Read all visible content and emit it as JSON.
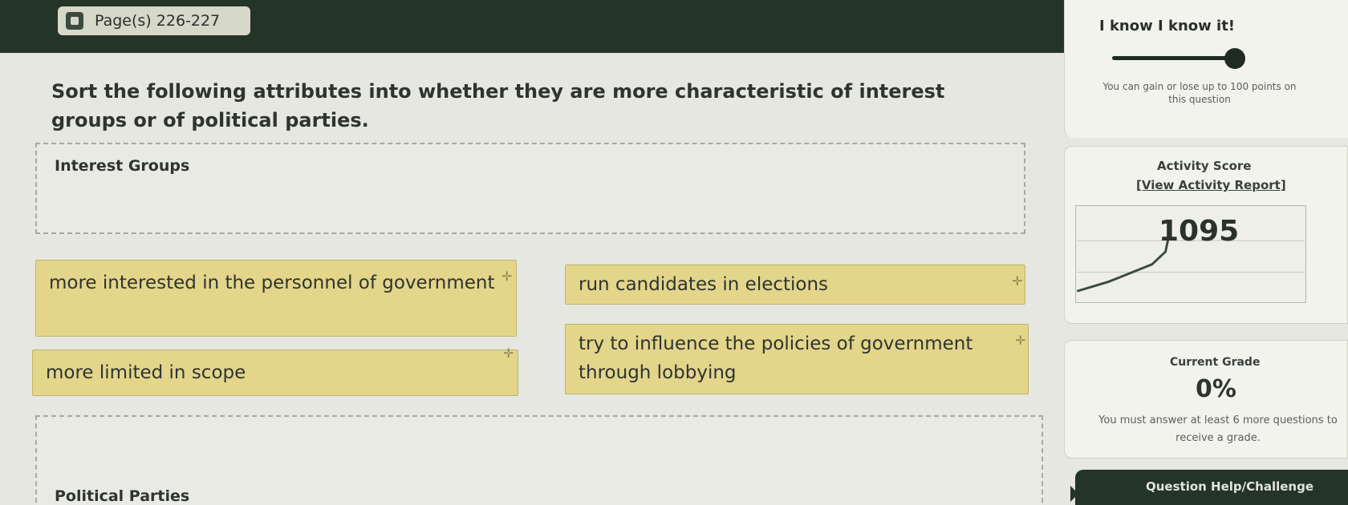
{
  "header": {
    "page_label": "Page(s) 226-227",
    "blurred_text": "",
    "mastery_title": "I know I know it!",
    "points_note": "You can gain or lose up to 100 points on this question"
  },
  "question": {
    "prompt": "Sort the following attributes into whether they are more characteristic of interest groups or of political parties."
  },
  "zones": {
    "interest_groups": "Interest Groups",
    "political_parties": "Political Parties"
  },
  "cards": [
    {
      "text": "more interested in the personnel of government"
    },
    {
      "text": "run candidates in elections"
    },
    {
      "text": "more limited in scope"
    },
    {
      "text": "try to influence the policies of government through lobbying"
    }
  ],
  "activity": {
    "title": "Activity Score",
    "report_link": "[View Activity Report]",
    "score": "1095"
  },
  "grade": {
    "title": "Current Grade",
    "value": "0%",
    "note": "You must answer at least 6 more questions to receive a grade."
  },
  "help": {
    "label": "Question Help/Challenge"
  },
  "colors": {
    "header_bg": "#243427",
    "card_bg": "#e3d58a",
    "page_bg": "#e6e7e0"
  }
}
